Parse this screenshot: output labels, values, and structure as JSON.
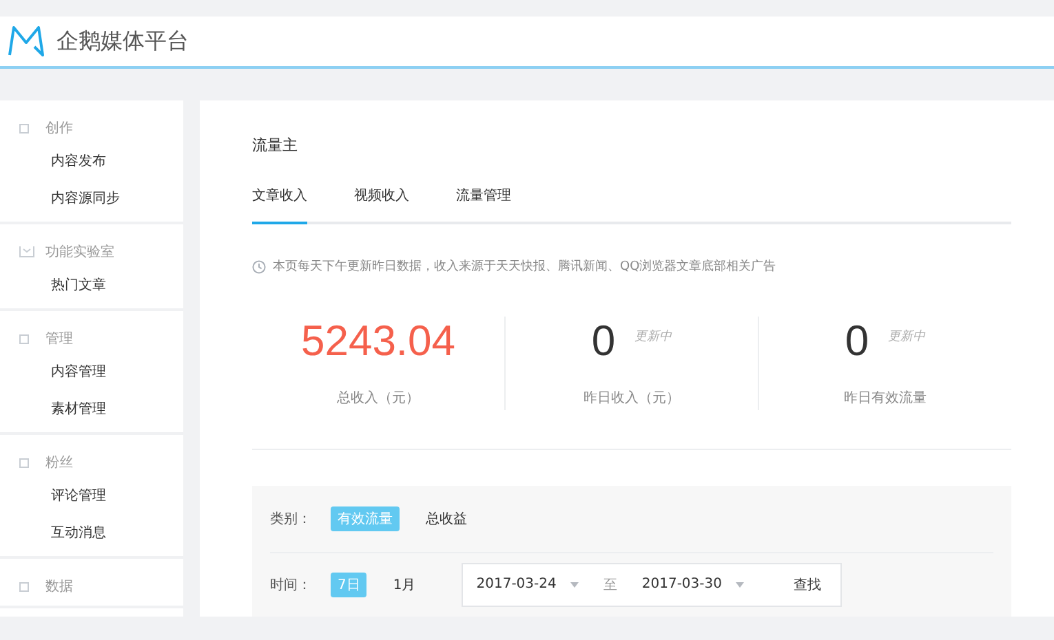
{
  "header": {
    "brand": "企鹅媒体平台"
  },
  "sidebar": {
    "groups": [
      {
        "title": "创作",
        "kind": "plain",
        "items": [
          "内容发布",
          "内容源同步"
        ]
      },
      {
        "title": "功能实验室",
        "kind": "lab",
        "items": [
          "热门文章"
        ]
      },
      {
        "title": "管理",
        "kind": "plain",
        "items": [
          "内容管理",
          "素材管理"
        ]
      },
      {
        "title": "粉丝",
        "kind": "plain",
        "items": [
          "评论管理",
          "互动消息"
        ]
      },
      {
        "title": "数据",
        "kind": "plain"
      }
    ]
  },
  "main": {
    "title": "流量主",
    "tabs": [
      {
        "label": "文章收入",
        "selected": true
      },
      {
        "label": "视频收入",
        "selected": false
      },
      {
        "label": "流量管理",
        "selected": false
      }
    ],
    "notice": "本页每天下午更新昨日数据，收入来源于天天快报、腾讯新闻、QQ浏览器文章底部相关广告",
    "stats": [
      {
        "value": "5243.04",
        "highlight": true,
        "label": "总收入（元）"
      },
      {
        "value": "0",
        "highlight": false,
        "status": "更新中",
        "label": "昨日收入（元）"
      },
      {
        "value": "0",
        "highlight": false,
        "status": "更新中",
        "label": "昨日有效流量"
      }
    ],
    "filter": {
      "category_label": "类别：",
      "categories": [
        {
          "label": "有效流量",
          "selected": true
        },
        {
          "label": "总收益",
          "selected": false
        }
      ],
      "time_label": "时间：",
      "periods": [
        {
          "label": "7日",
          "selected": true
        },
        {
          "label": "1月",
          "selected": false
        }
      ],
      "start_date": "2017-03-24",
      "separator": "至",
      "end_date": "2017-03-30",
      "search_button": "查找"
    }
  }
}
